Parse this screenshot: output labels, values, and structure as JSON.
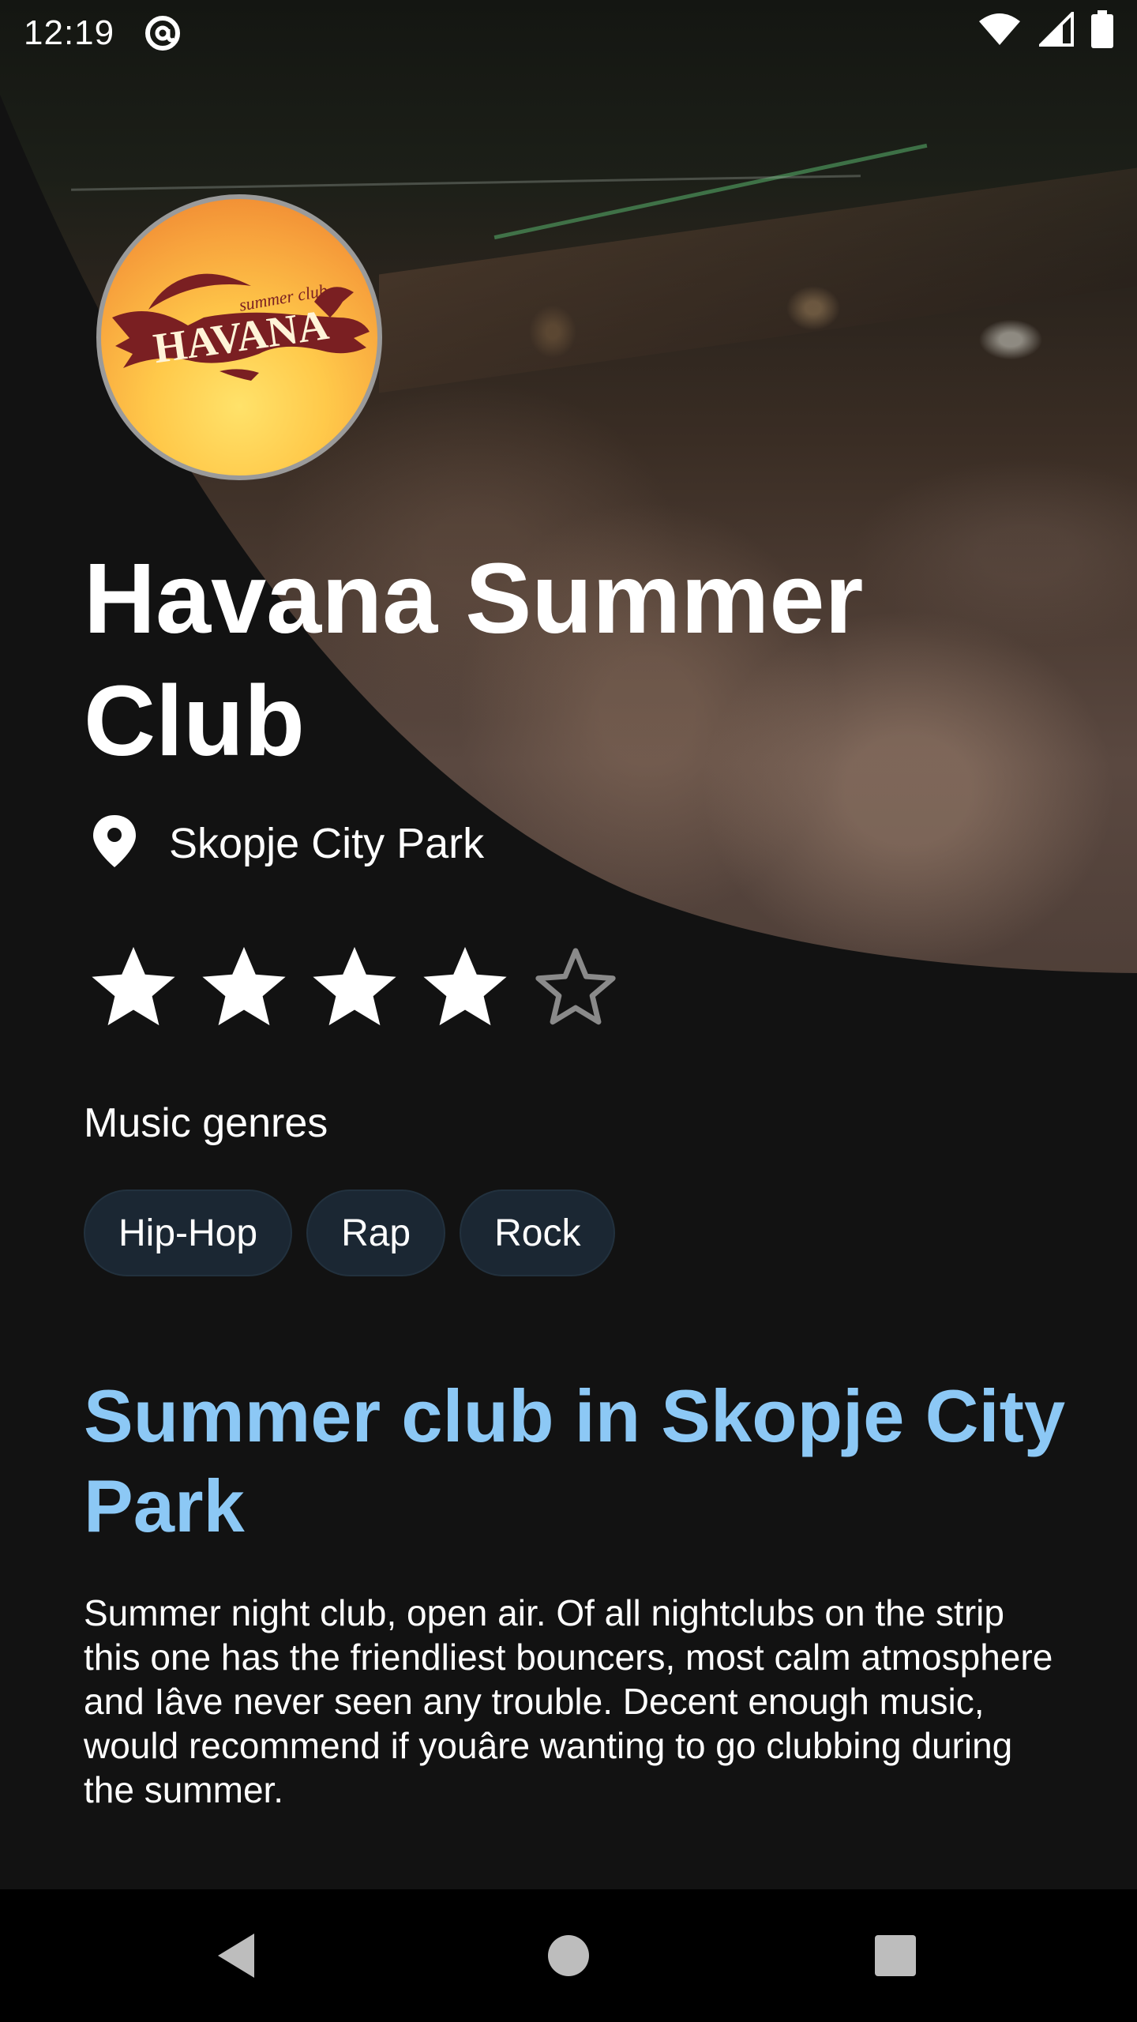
{
  "status_bar": {
    "time": "12:19",
    "icons": [
      "at-sign-icon",
      "wifi-icon",
      "signal-icon",
      "battery-icon"
    ]
  },
  "club": {
    "logo": {
      "alt": "Havana summer club logo",
      "text_main": "HAVANA",
      "text_small": "summer club"
    },
    "name": "Havana Summer Club",
    "location": "Skopje City Park",
    "location_icon": "map-pin-icon",
    "rating": {
      "value": 4,
      "max": 5
    }
  },
  "genres": {
    "label": "Music genres",
    "items": [
      "Hip-Hop",
      "Rap",
      "Rock"
    ]
  },
  "review": {
    "title": "Summer club in Skopje City Park",
    "body": "Summer night club, open air. Of all nightclubs on the strip this one has the friendliest bouncers, most calm atmosphere and Iâve never seen any trouble. Decent enough music, would recommend if youâre wanting to go clubbing during the summer."
  },
  "nav_bar": {
    "buttons": [
      "back-icon",
      "home-icon",
      "recents-icon"
    ]
  },
  "colors": {
    "background": "#121212",
    "accent_heading": "#8cc8f5",
    "chip_bg": "#1b2733",
    "nav_bg": "#000000"
  }
}
